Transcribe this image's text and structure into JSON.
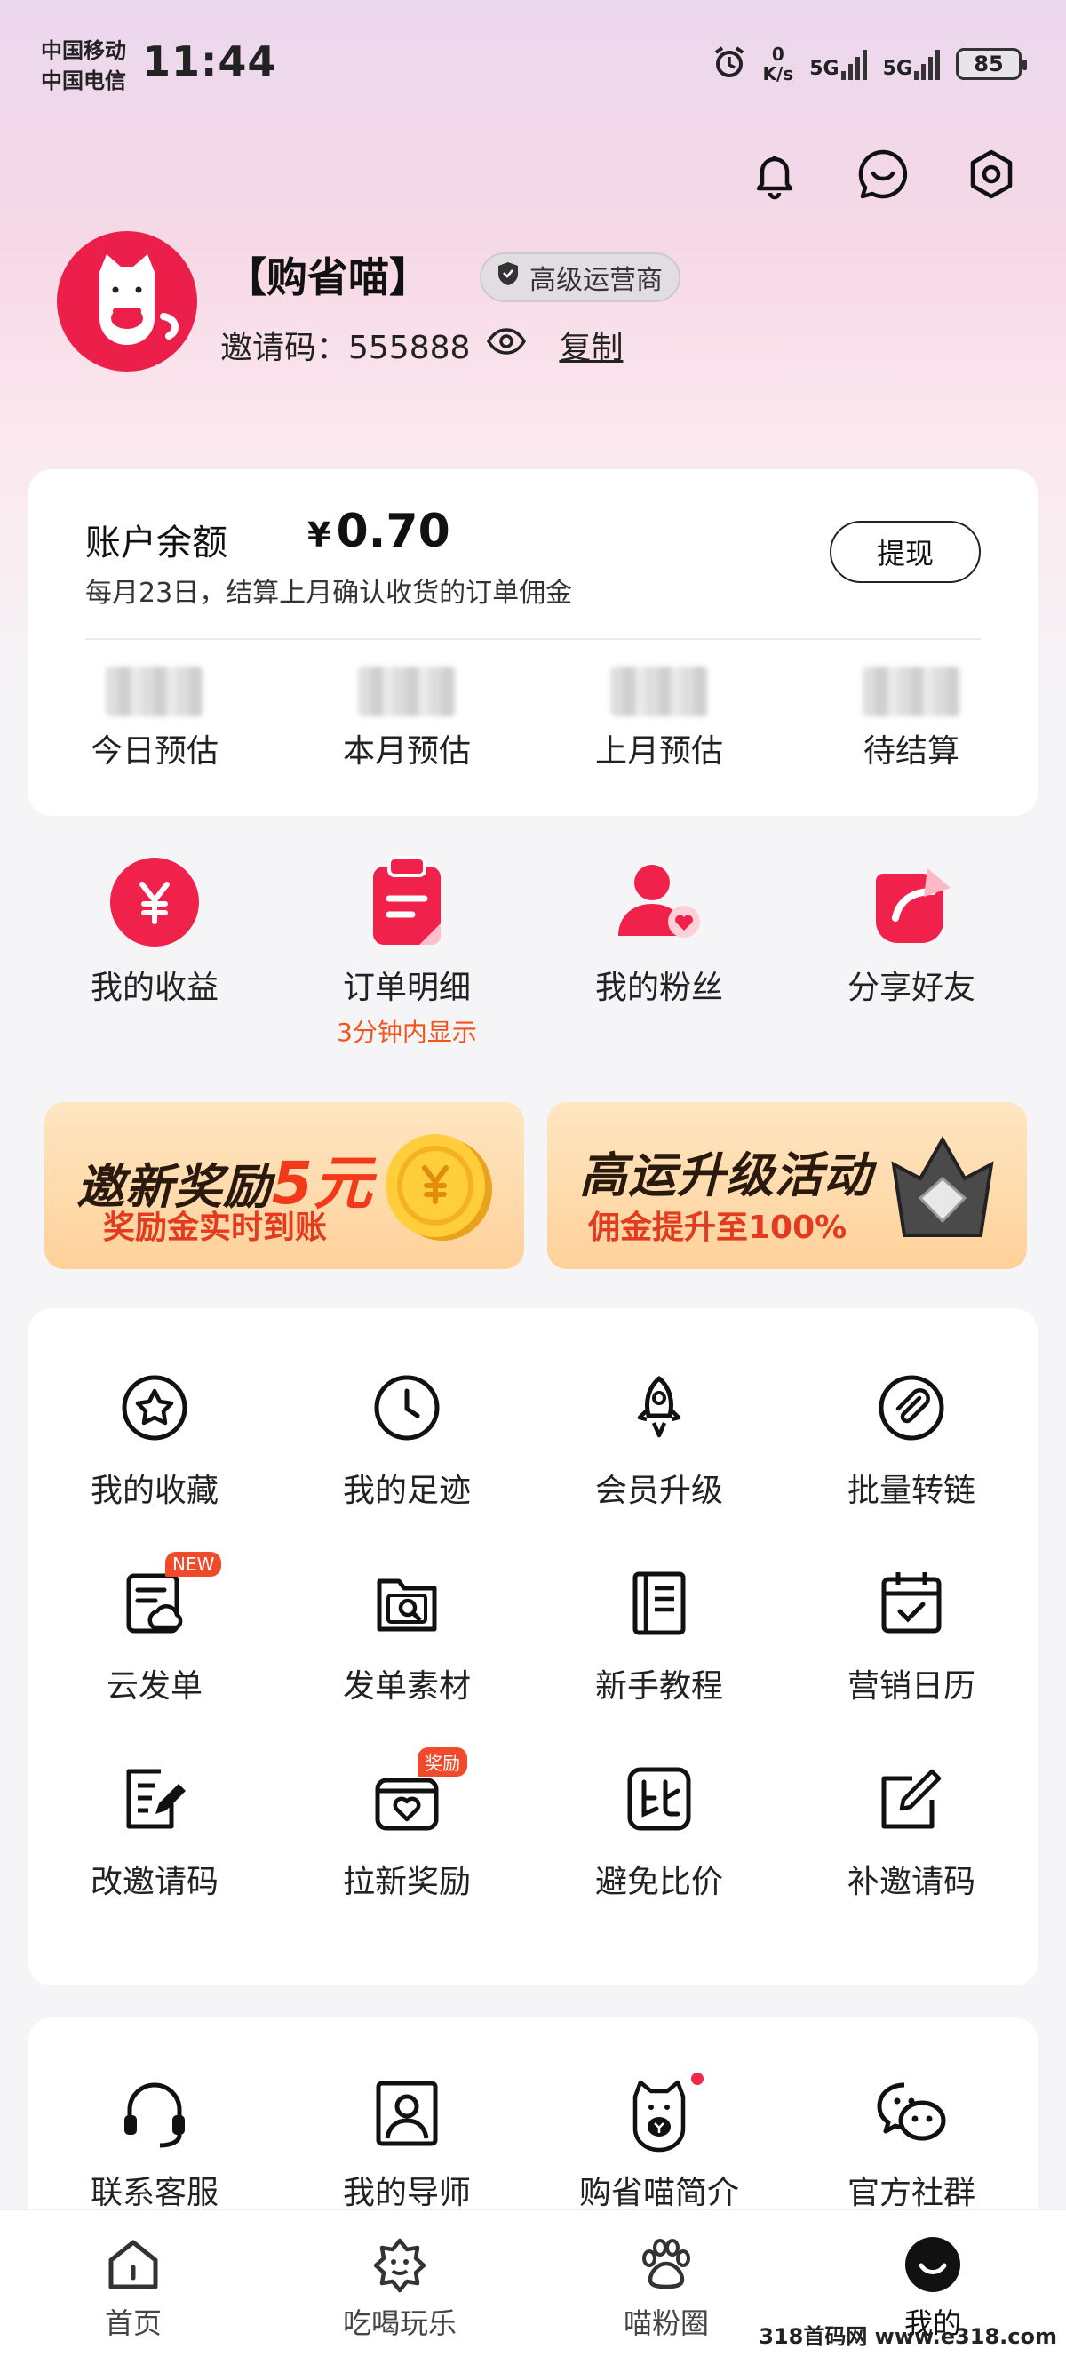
{
  "status_bar": {
    "carrier_1": "中国移动",
    "carrier_2": "中国电信",
    "time": "11:44",
    "net_speed_value": "0",
    "net_speed_unit": "K/s",
    "signal_1": "5G",
    "signal_2": "5G",
    "battery": "85"
  },
  "header": {
    "icons": [
      "bell-icon",
      "chat-icon",
      "settings-icon"
    ]
  },
  "profile": {
    "nickname": "【购省喵】",
    "role_badge": "高级运营商",
    "invite_label": "邀请码：555888",
    "copy_label": "复制"
  },
  "balance": {
    "label": "账户余额",
    "currency": "¥",
    "amount": "0.70",
    "note": "每月23日，结算上月确认收货的订单佣金",
    "withdraw_label": "提现",
    "stats": [
      {
        "label": "今日预估"
      },
      {
        "label": "本月预估"
      },
      {
        "label": "上月预估"
      },
      {
        "label": "待结算"
      }
    ]
  },
  "quick_actions": [
    {
      "label": "我的收益",
      "icon": "yuan-coin-icon"
    },
    {
      "label": "订单明细",
      "sub": "3分钟内显示",
      "icon": "order-clipboard-icon"
    },
    {
      "label": "我的粉丝",
      "icon": "fans-person-icon"
    },
    {
      "label": "分享好友",
      "icon": "share-arrow-icon"
    }
  ],
  "banners": [
    {
      "title": "邀新奖励",
      "title_accent": "5元",
      "subtitle": "奖励金实时到账"
    },
    {
      "title": "高运升级活动",
      "subtitle": "佣金提升至100%"
    }
  ],
  "tools": [
    {
      "label": "我的收藏",
      "icon": "star-circle-icon"
    },
    {
      "label": "我的足迹",
      "icon": "clock-icon"
    },
    {
      "label": "会员升级",
      "icon": "rocket-icon"
    },
    {
      "label": "批量转链",
      "icon": "link-clip-icon"
    },
    {
      "label": "云发单",
      "icon": "cloud-doc-icon",
      "tag": "NEW"
    },
    {
      "label": "发单素材",
      "icon": "folder-search-icon"
    },
    {
      "label": "新手教程",
      "icon": "book-icon"
    },
    {
      "label": "营销日历",
      "icon": "calendar-check-icon"
    },
    {
      "label": "改邀请码",
      "icon": "edit-doc-icon"
    },
    {
      "label": "拉新奖励",
      "icon": "heart-box-icon",
      "tag": "奖励"
    },
    {
      "label": "避免比价",
      "icon": "compare-icon"
    },
    {
      "label": "补邀请码",
      "icon": "edit-square-icon"
    }
  ],
  "services": [
    {
      "label": "联系客服",
      "icon": "headset-icon"
    },
    {
      "label": "我的导师",
      "icon": "mentor-portrait-icon"
    },
    {
      "label": "购省喵简介",
      "icon": "cat-mascot-icon"
    },
    {
      "label": "官方社群",
      "icon": "wechat-icon"
    }
  ],
  "bottom_nav": [
    {
      "label": "首页",
      "icon": "home-icon"
    },
    {
      "label": "吃喝玩乐",
      "icon": "food-fun-icon"
    },
    {
      "label": "喵粉圈",
      "icon": "paw-icon"
    },
    {
      "label": "我的",
      "icon": "profile-smile-icon",
      "active": true
    }
  ],
  "watermark": "318首码网 www.e318.com",
  "colors": {
    "brand_red": "#ec1f4a",
    "accent_orange": "#f2541b",
    "banner_bg": "#ffd19a"
  }
}
